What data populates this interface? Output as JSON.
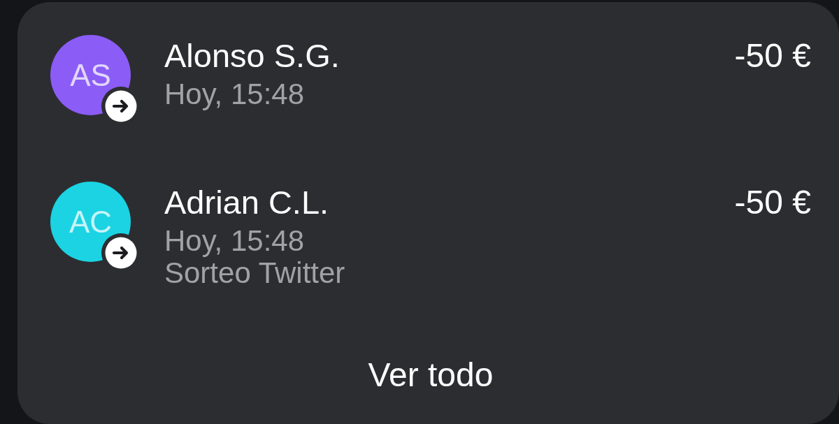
{
  "transactions": [
    {
      "initials": "AS",
      "color": "#8b5cf6",
      "name": "Alonso S.G.",
      "time": "Hoy, 15:48",
      "amount": "-50 €"
    },
    {
      "initials": "AC",
      "color": "#1bd3e3",
      "name": "Adrian C.L.",
      "time": "Hoy, 15:48",
      "note": "Sorteo Twitter",
      "amount": "-50 €"
    }
  ],
  "view_all": "Ver todo"
}
